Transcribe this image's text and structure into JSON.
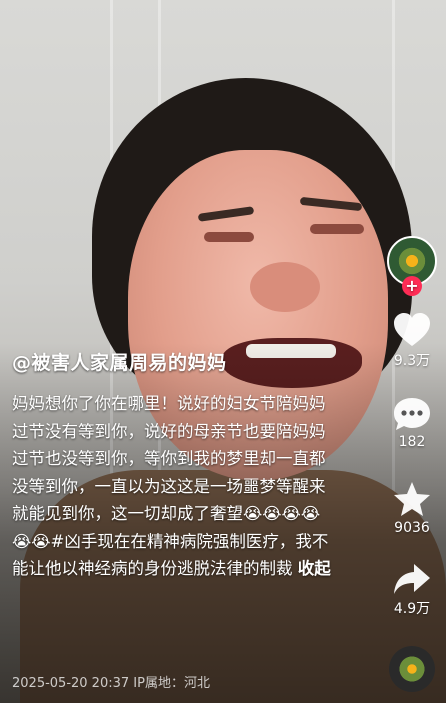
{
  "post": {
    "author": "@被害人家属周易的妈妈",
    "description": "妈妈想你了你在哪里！说好的妇女节陪妈妈过节没有等到你，说好的母亲节也要陪妈妈过节也没等到你，等你到我的梦里却一直都没等到你，一直以为这这是一场噩梦等醒来就能见到你，这一切却成了奢望😭😭😭😭😭😭#凶手现在在精神病院强制医疗，我不能让他以神经病的身份逃脱法律的制裁",
    "more_label": "收起",
    "timestamp": "2025-05-20 20:37",
    "ip_location": "IP属地：河北"
  },
  "rail": {
    "follow_symbol": "+",
    "likes": "9.3万",
    "comments": "182",
    "favorites": "9036",
    "shares": "4.9万"
  },
  "colors": {
    "follow": "#fe2c55",
    "text": "#ffffff"
  }
}
